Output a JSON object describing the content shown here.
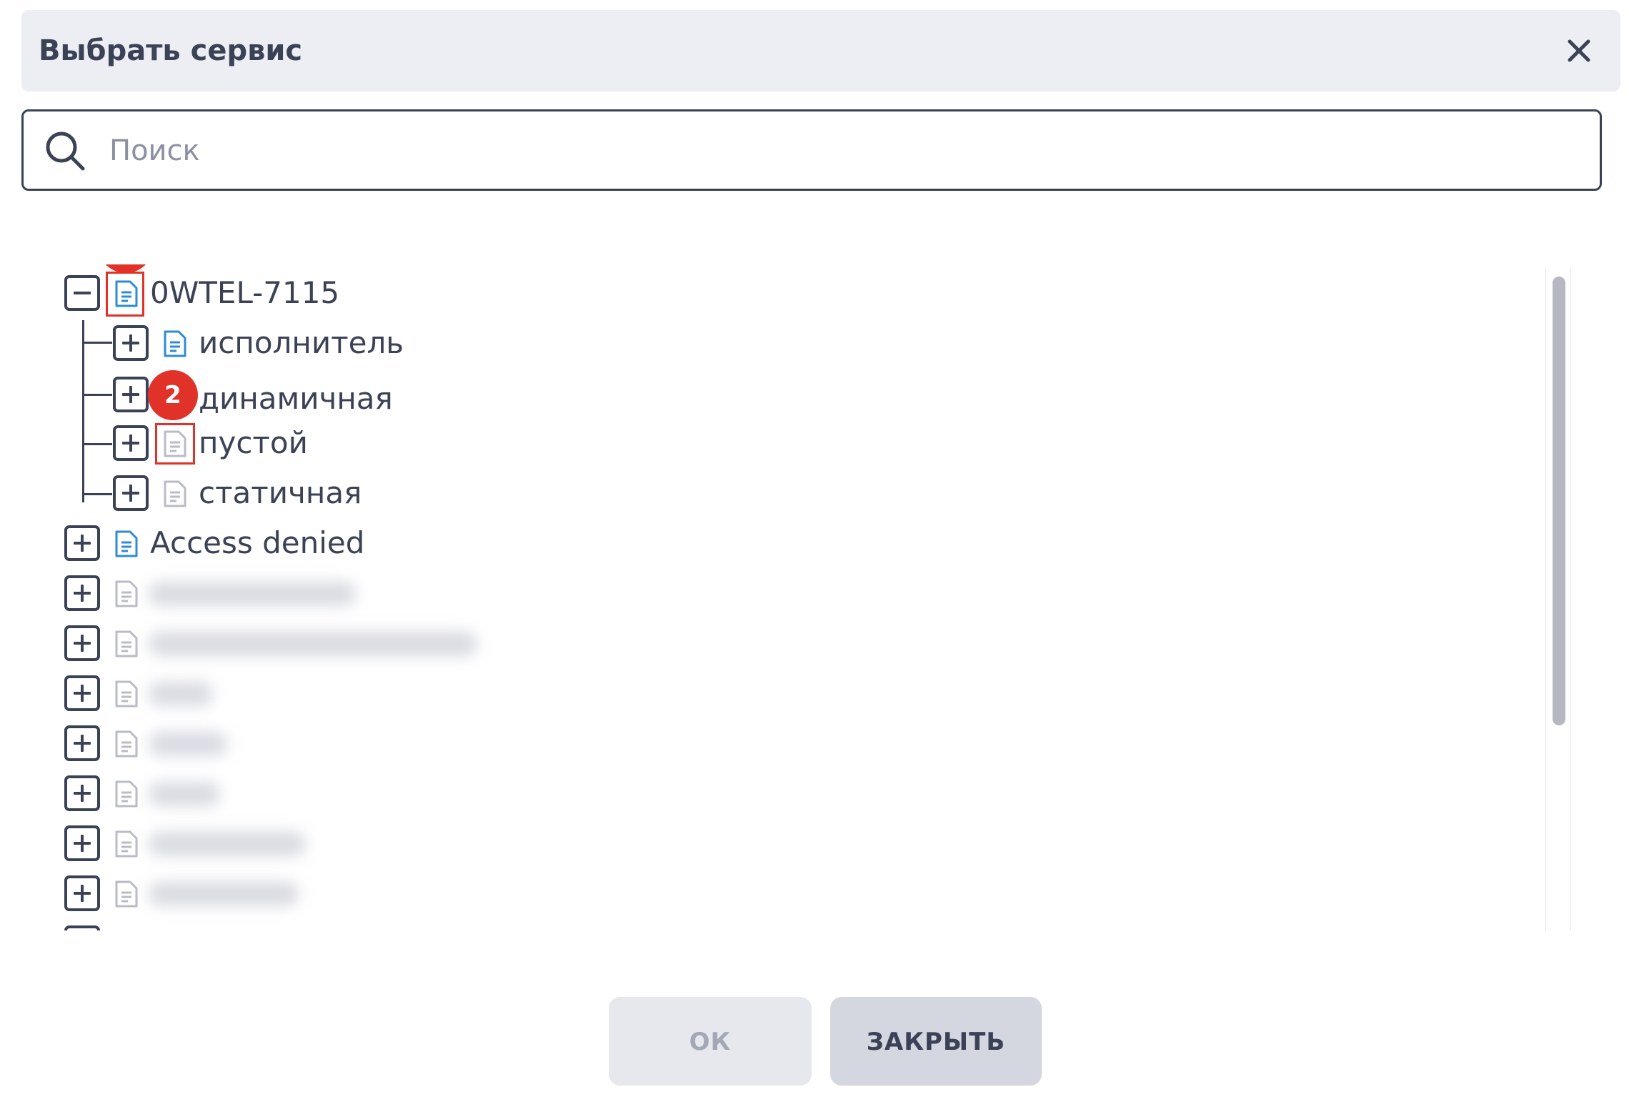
{
  "dialog": {
    "title": "Выбрать сервис",
    "close_icon": "close-icon"
  },
  "search": {
    "placeholder": "Поиск",
    "value": "",
    "icon": "search-icon"
  },
  "tree": {
    "root": {
      "label": "0WTEL-7115",
      "expanded": true,
      "icon": "document-icon",
      "icon_color": "#2f8bd6",
      "annotation": "1",
      "children": [
        {
          "label": "исполнитель",
          "icon_color": "#2f8bd6"
        },
        {
          "label": "динамичная",
          "icon_color": "#b9bcc6",
          "annotation": "2"
        },
        {
          "label": "пустой",
          "icon_color": "#b9bcc6"
        },
        {
          "label": "статичная",
          "icon_color": "#b9bcc6"
        }
      ]
    },
    "items": [
      {
        "label": "Access denied",
        "icon_color": "#2f8bd6"
      }
    ]
  },
  "buttons": {
    "ok": "ОК",
    "close": "ЗАКРЫТЬ"
  },
  "colors": {
    "accent_blue": "#2f8bd6",
    "annotation_red": "#e1322a",
    "text": "#3b4256"
  }
}
